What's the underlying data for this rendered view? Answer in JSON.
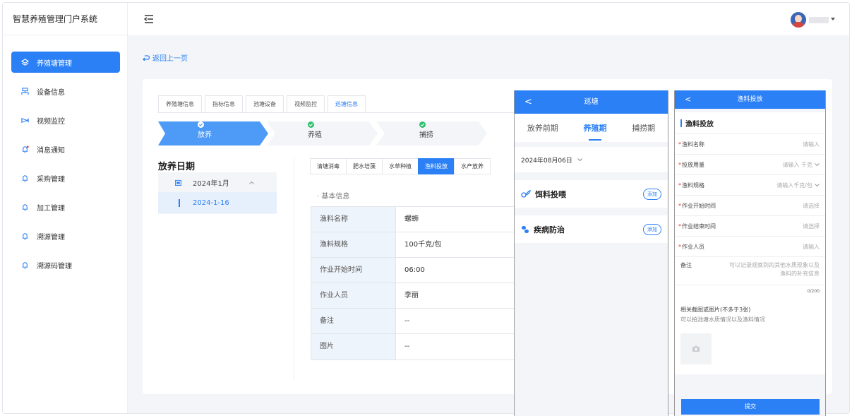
{
  "app": {
    "title": "智慧养殖管理门户系统"
  },
  "sidebar": {
    "items": [
      {
        "label": "养殖塘管理"
      },
      {
        "label": "设备信息"
      },
      {
        "label": "视频监控"
      },
      {
        "label": "消息通知"
      },
      {
        "label": "采购管理"
      },
      {
        "label": "加工管理"
      },
      {
        "label": "溯源管理"
      },
      {
        "label": "溯源码管理"
      }
    ]
  },
  "nav": {
    "back_label": "返回上一页"
  },
  "tabs": [
    {
      "label": "养殖塘信息"
    },
    {
      "label": "指标信息"
    },
    {
      "label": "池塘设备"
    },
    {
      "label": "视频监控"
    },
    {
      "label": "巡塘信息"
    }
  ],
  "steps": [
    {
      "label": "放养"
    },
    {
      "label": "养殖"
    },
    {
      "label": "捕捞"
    }
  ],
  "date_section": {
    "title": "放养日期",
    "month": "2024年1月",
    "day": "2024-1-16"
  },
  "subtabs": [
    {
      "label": "清塘消毒"
    },
    {
      "label": "肥水培藻"
    },
    {
      "label": "水草种植"
    },
    {
      "label": "渔料投放"
    },
    {
      "label": "水产放养"
    }
  ],
  "basic_info": {
    "title": "· 基本信息",
    "rows": [
      {
        "label": "渔料名称",
        "value": "螺蛳"
      },
      {
        "label": "渔料规格",
        "value": "100千克/包"
      },
      {
        "label": "作业开始时间",
        "value": "06:00"
      },
      {
        "label": "作业人员",
        "value": "李丽"
      },
      {
        "label": "备注",
        "value": "--"
      },
      {
        "label": "图片",
        "value": "--"
      }
    ]
  },
  "phone1": {
    "title": "巡塘",
    "back": "<",
    "tabs": [
      {
        "label": "放养前期"
      },
      {
        "label": "养殖期"
      },
      {
        "label": "捕捞期"
      }
    ],
    "date": "2024年08月06日",
    "sections": [
      {
        "label": "饵料投喂",
        "btn": "添加"
      },
      {
        "label": "疾病防治",
        "btn": "添加"
      }
    ]
  },
  "phone2": {
    "title": "渔料投放",
    "back": "<",
    "form_title": "渔料投放",
    "fields": [
      {
        "label": "渔料名称",
        "placeholder": "请输入",
        "required": "*"
      },
      {
        "label": "投放用量",
        "placeholder": "请输入 千克",
        "required": "*"
      },
      {
        "label": "渔料规格",
        "placeholder": "请输入千克/包",
        "required": "*"
      },
      {
        "label": "作业开始时间",
        "placeholder": "请选择",
        "required": "*"
      },
      {
        "label": "作业结束时间",
        "placeholder": "请选择",
        "required": "*"
      },
      {
        "label": "作业人员",
        "placeholder": "请输入",
        "required": "*"
      }
    ],
    "note_label": "备注",
    "note_placeholder": "可以记录观察到的其他水质现象以及渔料的补充信息",
    "counter": "0/200",
    "image_label": "相关截图或图片(不多于3张)",
    "image_hint": "可以拍池塘水质情况以及渔料情况",
    "submit": "提交"
  },
  "colors": {
    "primary": "#2b80f6",
    "bg": "#f3f5f8"
  }
}
